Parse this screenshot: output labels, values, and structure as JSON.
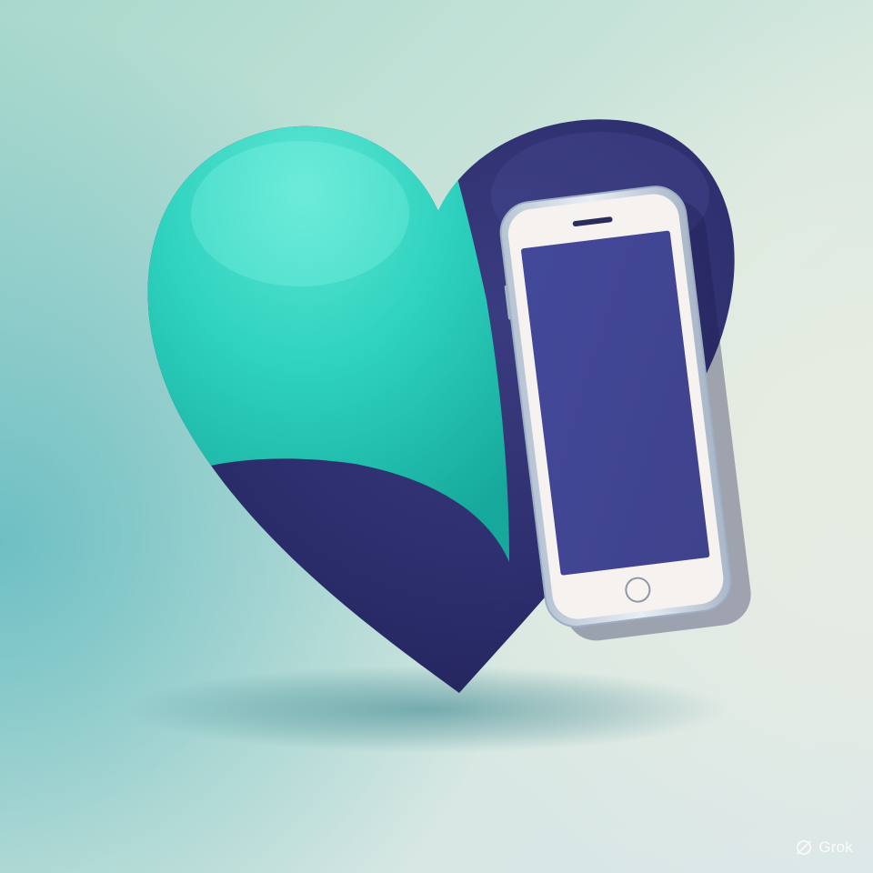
{
  "scene": {
    "subject": "heart-with-smartphone",
    "colors": {
      "background_top": "#a8d8cc",
      "background_right": "#e9ede2",
      "background_left": "#5fb9c0",
      "background_bottom": "#d9e6ea",
      "heart_teal": "#2fd3bf",
      "heart_teal_light": "#5ee6d3",
      "heart_teal_dark": "#16a99b",
      "heart_navy": "#2a2c6a",
      "heart_navy_dark": "#1d1e4e",
      "phone_frame": "#e9eef4",
      "phone_bezel": "#f6f2ef",
      "phone_screen": "#3f438c",
      "shadow": "#2f7e86"
    },
    "watermark": {
      "text": "Grok",
      "icon": "grok-logo-icon",
      "color": "#ffffff"
    }
  }
}
